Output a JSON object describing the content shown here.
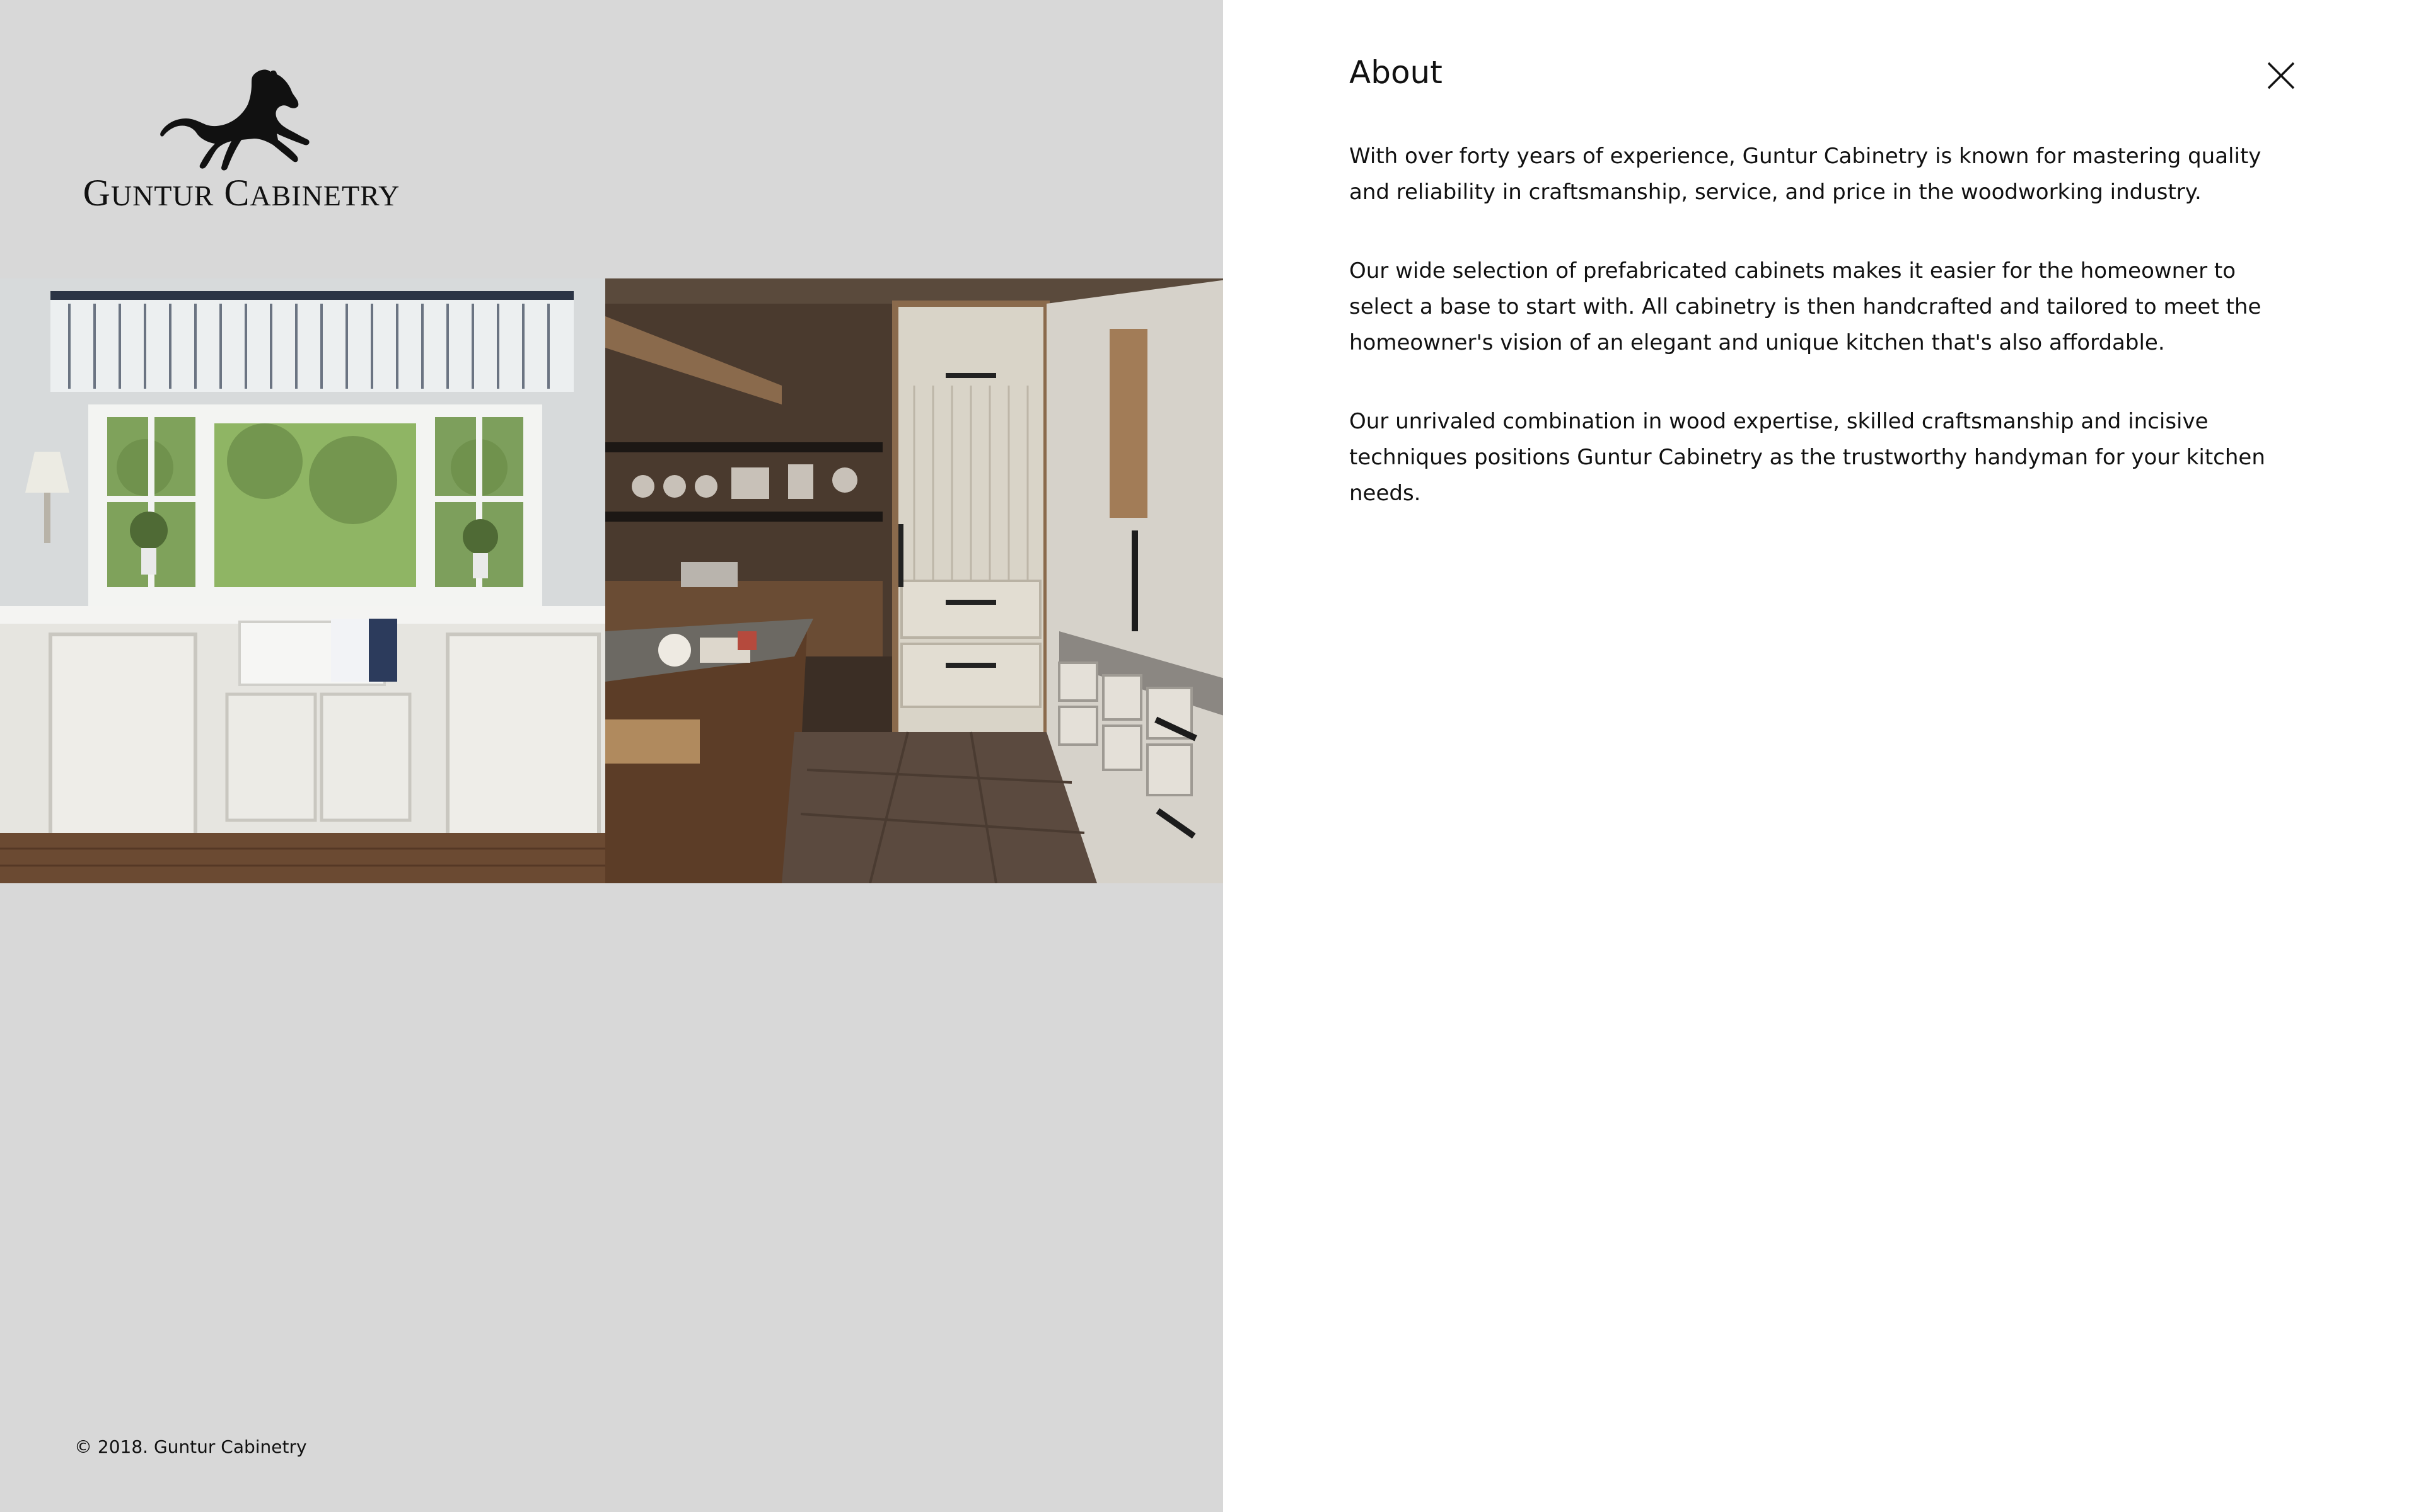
{
  "brand": {
    "name_first_initial": "G",
    "name_first_rest": "UNTUR",
    "name_last_initial": "C",
    "name_last_rest": "ABINETRY",
    "logo_icon": "horse-icon"
  },
  "gallery": {
    "images": [
      {
        "alt": "white-kitchen-bay-window"
      },
      {
        "alt": "wood-and-white-kitchen-pantry"
      }
    ]
  },
  "footer": {
    "copyright": "© 2018. Guntur Cabinetry"
  },
  "about": {
    "title": "About",
    "close_icon": "close-icon",
    "paragraphs": [
      "With over forty years of experience, Guntur Cabinetry is known for mastering quality and reliability in craftsmanship, service, and price in the woodworking industry.",
      "Our wide selection of prefabricated cabinets makes it easier for the homeowner to select a base to start with. All cabinetry is then handcrafted and tailored to meet the homeowner's vision of an elegant and unique kitchen that's also affordable.",
      "Our unrivaled combination in wood expertise, skilled craftsmanship and incisive techniques positions Guntur Cabinetry as the trustworthy handyman for your kitchen needs."
    ]
  },
  "colors": {
    "left_background": "#d8d8d8",
    "panel_background": "#ffffff",
    "text": "#111111"
  }
}
